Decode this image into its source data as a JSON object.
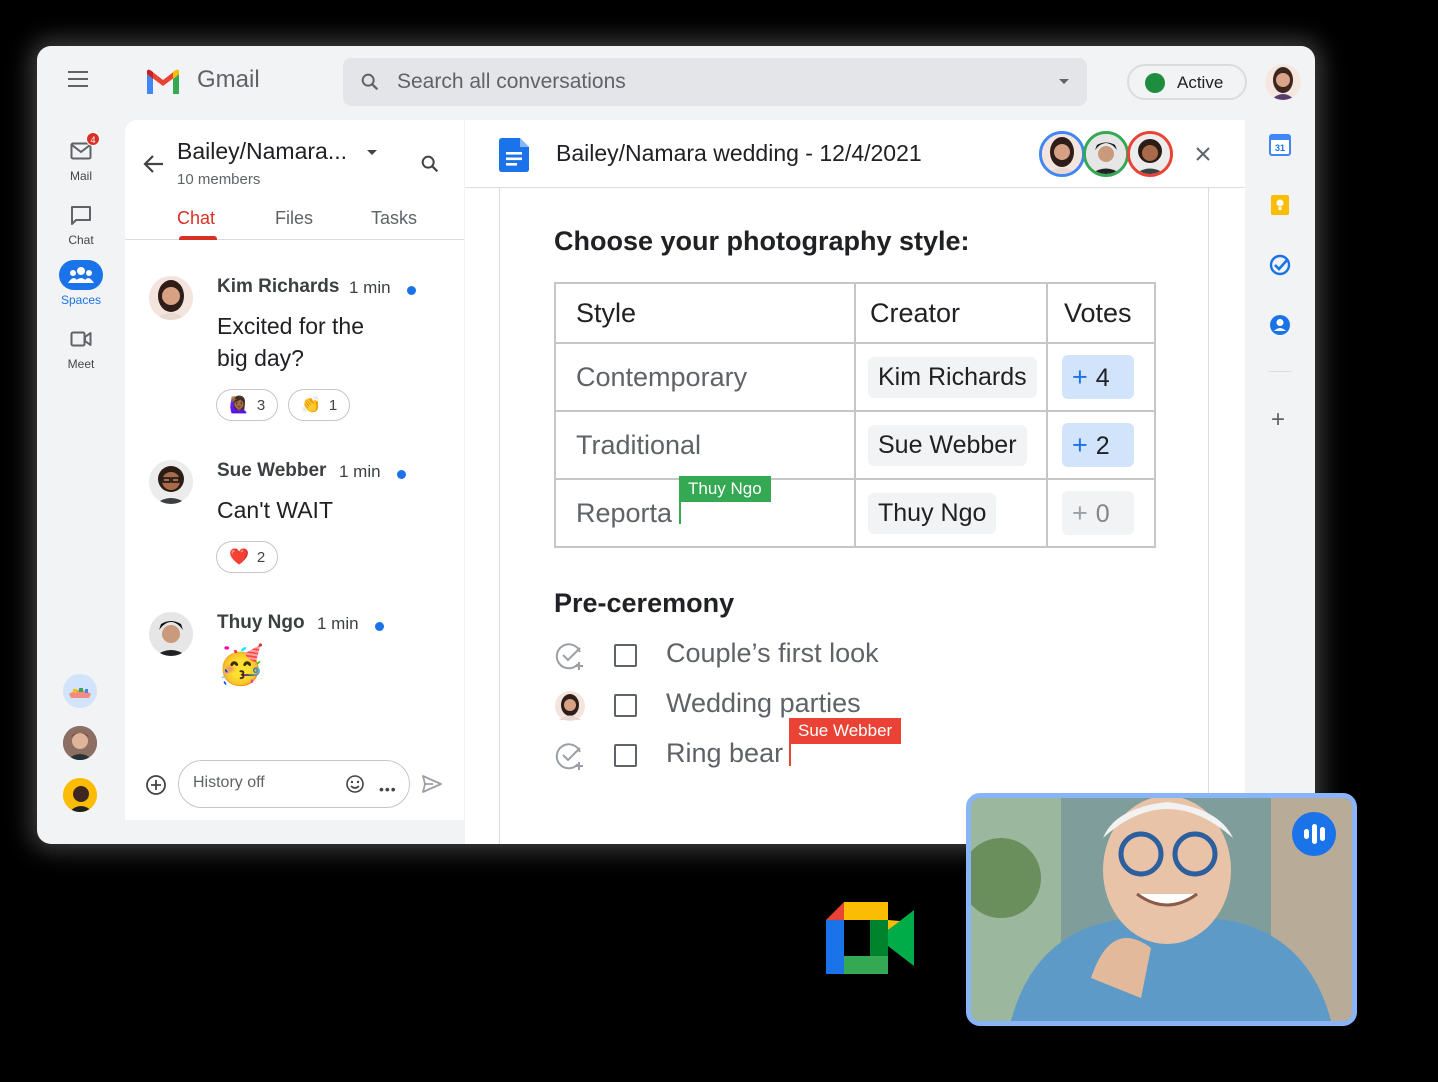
{
  "app": {
    "name": "Gmail"
  },
  "search": {
    "placeholder": "Search all conversations"
  },
  "status": {
    "label": "Active",
    "color": "#1e8e3e"
  },
  "left_rail": {
    "items": [
      {
        "label": "Mail",
        "badge": "4"
      },
      {
        "label": "Chat"
      },
      {
        "label": "Spaces"
      },
      {
        "label": "Meet"
      }
    ]
  },
  "space": {
    "title": "Bailey/Namara...",
    "members": "10 members",
    "tabs": [
      "Chat",
      "Files",
      "Tasks"
    ],
    "active_tab": "Chat"
  },
  "messages": [
    {
      "name": "Kim Richards",
      "time": "1 min",
      "body_lines": [
        "Excited for the",
        "big day?"
      ],
      "reactions": [
        {
          "emoji": "🙋🏾‍♀️",
          "count": "3"
        },
        {
          "emoji": "👏",
          "count": "1"
        }
      ]
    },
    {
      "name": "Sue Webber",
      "time": "1 min",
      "body_lines": [
        "Can't WAIT"
      ],
      "reactions": [
        {
          "emoji": "❤️",
          "count": "2"
        }
      ]
    },
    {
      "name": "Thuy Ngo",
      "time": "1 min",
      "body_lines": [
        "🥳"
      ],
      "reactions": []
    }
  ],
  "compose": {
    "placeholder": "History off"
  },
  "doc": {
    "title": "Bailey/Namara wedding - 12/4/2021",
    "heading": "Choose your photography style:",
    "table": {
      "headers": [
        "Style",
        "Creator",
        "Votes"
      ],
      "rows": [
        {
          "style": "Contemporary",
          "creator": "Kim Richards",
          "votes": "4"
        },
        {
          "style": "Traditional",
          "creator": "Sue Webber",
          "votes": "2"
        },
        {
          "style": "Reporta",
          "creator": "Thuy Ngo",
          "votes": "0"
        }
      ]
    },
    "cursor_flags": [
      {
        "name": "Thuy Ngo",
        "color": "#34a853"
      },
      {
        "name": "Sue Webber",
        "color": "#ea4335"
      }
    ],
    "section2": "Pre-ceremony",
    "checklist": [
      "Couple’s first look",
      "Wedding parties",
      "Ring bear"
    ]
  },
  "colors": {
    "accent": "#1a73e8",
    "brand_red": "#d93025",
    "collab_blue": "#4285f4",
    "collab_green": "#34a853",
    "collab_red": "#ea4335"
  },
  "icons": [
    "menu-icon",
    "search-icon",
    "mail-icon",
    "chat-icon",
    "spaces-icon",
    "meet-icon",
    "back-arrow-icon",
    "add-icon",
    "emoji-icon",
    "more-icon",
    "send-icon",
    "docs-icon",
    "close-icon",
    "calendar-icon",
    "keep-icon",
    "tasks-icon",
    "contacts-icon",
    "mic-active-icon",
    "google-meet-logo"
  ]
}
